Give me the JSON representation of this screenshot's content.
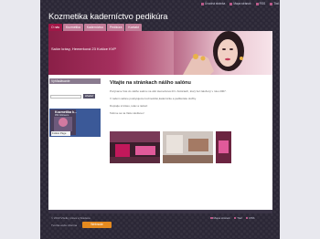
{
  "top_nav": [
    "Úvodná stránka",
    "Mapa stránok",
    "RSS",
    "Tlač"
  ],
  "site_title": "Kozmetika kaderníctvo pedikúra",
  "tabs": [
    "O nás",
    "Kozmetika",
    "Kaderníctvo",
    "Pedikúra",
    "Kontakt"
  ],
  "banner_text": "Salón krásy, Hemerková 23 Košice KVP",
  "sidebar": {
    "search_heading": "Vyhľadávanie",
    "search_placeholder": "",
    "search_button": "Hľadať",
    "facebook_title": "Kozmetika k...",
    "facebook_subtitle": "954 followers",
    "facebook_follow": "Follow Page"
  },
  "main": {
    "title": "Vitajte na stránkach nášho salónu",
    "paragraphs": [
      "Pozývame Vás do nášho salónu na ulici Hemerková 23 v Košiciach, ktorý bol založený v roku 2007.",
      "V našom salóne poskytujeme kozmetické,kadernícke a pedikérske služby.",
      "Doprajte si krásu, relax a radosť.",
      "Tešíme sa na Vašu návštevu!"
    ]
  },
  "footer": {
    "copyright": "© 2013 Všetky práva vyhradené.",
    "links": [
      "Mapa stránok",
      "Tlač",
      "RSS"
    ],
    "created_with": "Tvorba webu zdarma",
    "created_badge": "Webnode"
  },
  "colors": {
    "accent": "#a11747",
    "tab": "#c17c98",
    "background": "#2b2736",
    "footer_badge": "#e58a1f"
  }
}
